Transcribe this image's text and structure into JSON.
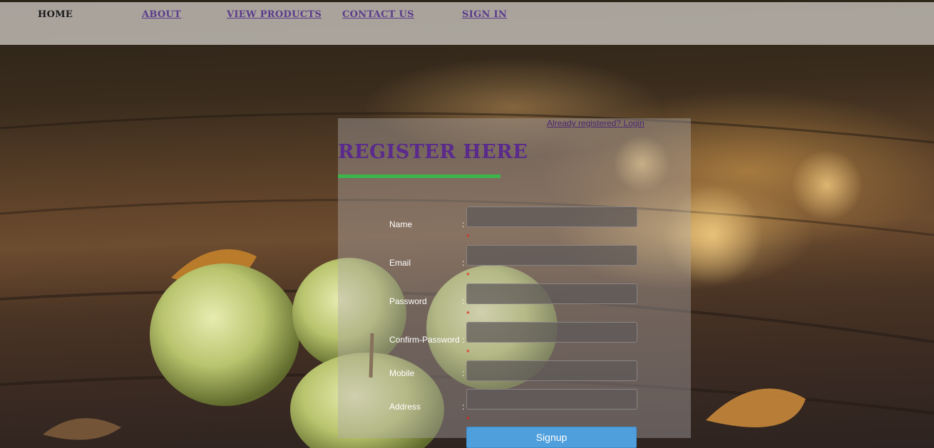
{
  "nav": {
    "home": "HOME",
    "about": "ABOUT",
    "view_products": "VIEW PRODUCTS",
    "contact_us": "CONTACT US",
    "sign_in": "SIGN IN"
  },
  "register": {
    "login_link": "Already registered? Login",
    "title": "REGISTER HERE",
    "colon": ":",
    "required_mark": "*",
    "fields": [
      {
        "label": "Name",
        "value": ""
      },
      {
        "label": "Email",
        "value": ""
      },
      {
        "label": "Password",
        "value": ""
      },
      {
        "label": "Confirm-Password",
        "value": ""
      },
      {
        "label": "Mobile",
        "value": ""
      },
      {
        "label": "Address",
        "value": ""
      }
    ],
    "submit_label": "Signup"
  },
  "colors": {
    "nav_link": "#5b3b8c",
    "title": "#5a2a8c",
    "title_underline": "#3cb64b",
    "required": "#e2231a",
    "button": "#4f9fdd"
  }
}
